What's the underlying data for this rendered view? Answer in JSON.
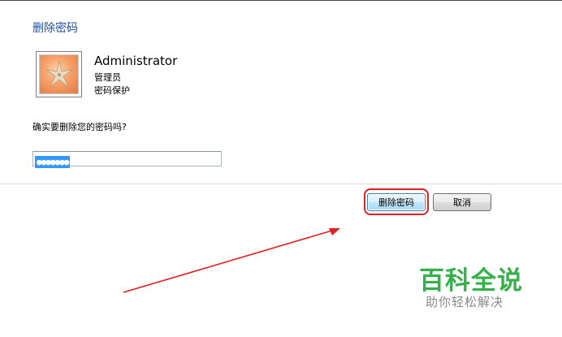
{
  "dialog": {
    "heading": "删除密码",
    "user": {
      "name": "Administrator",
      "role": "管理员",
      "status": "密码保护"
    },
    "question": "确实要删除您的密码吗?",
    "password": {
      "masked_value": "●●●●●●●"
    },
    "buttons": {
      "delete_label": "删除密码",
      "cancel_label": "取消"
    }
  },
  "annotation": {
    "highlight_color": "#e02020",
    "target": "delete-password-button"
  },
  "watermark": {
    "title": "百科全说",
    "subtitle": "助你轻松解决",
    "title_color": "#36b04a"
  },
  "icons": {
    "avatar": "starfish-icon"
  }
}
